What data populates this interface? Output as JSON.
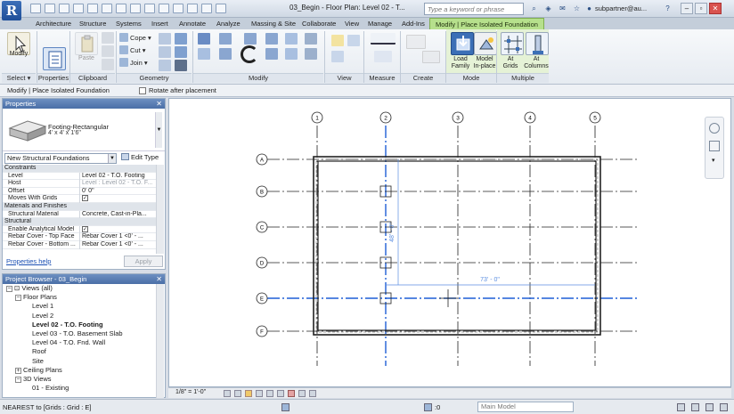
{
  "app": {
    "logo_letter": "R",
    "doc_title": "03_Begin - Floor Plan: Level 02 - T...",
    "search_placeholder": "Type a keyword or phrase",
    "user": "subpartner@au..."
  },
  "tabs": [
    "Architecture",
    "Structure",
    "Systems",
    "Insert",
    "Annotate",
    "Analyze",
    "Massing & Site",
    "Collaborate",
    "View",
    "Manage",
    "Add-Ins",
    "Modify | Place Isolated Foundation"
  ],
  "ribbon": {
    "select_label": "Select ▾",
    "panels": {
      "properties": "Properties",
      "clipboard": "Clipboard",
      "geometry": "Geometry",
      "modify": "Modify",
      "view": "View",
      "measure": "Measure",
      "create": "Create",
      "mode": "Mode",
      "multiple": "Multiple"
    },
    "modify_btn": "Modify",
    "paste": "Paste",
    "cope": "Cope",
    "cut": "Cut",
    "join": "Join",
    "load_family": [
      "Load",
      "Family"
    ],
    "model_inplace": [
      "Model",
      "In-place"
    ],
    "at_grids": [
      "At",
      "Grids"
    ],
    "at_columns": [
      "At",
      "Columns"
    ]
  },
  "optbar": {
    "mode": "Modify | Place Isolated Foundation",
    "rotate": "Rotate after placement"
  },
  "properties": {
    "title": "Properties",
    "family": "Footing-Rectangular",
    "type": "4' x 4' x 1'6\"",
    "instance_dropdown": "New Structural Foundations",
    "edit_type": "Edit Type",
    "rows": [
      {
        "k": "Constraints",
        "v": "",
        "sec": true
      },
      {
        "k": "Level",
        "v": "Level 02 - T.O. Footing"
      },
      {
        "k": "Host",
        "v": "Level : Level 02 - T.O. F...",
        "dim": true
      },
      {
        "k": "Offset",
        "v": "0' 0\""
      },
      {
        "k": "Moves With Grids",
        "v": "✓",
        "check": true
      },
      {
        "k": "Materials and Finishes",
        "v": "",
        "sec": true
      },
      {
        "k": "Structural Material",
        "v": "Concrete, Cast-in-Pla..."
      },
      {
        "k": "Structural",
        "v": "",
        "sec": true
      },
      {
        "k": "Enable Analytical Model",
        "v": "✓",
        "check": true
      },
      {
        "k": "Rebar Cover - Top Face",
        "v": "Rebar Cover 1 <0' - ..."
      },
      {
        "k": "Rebar Cover - Bottom ...",
        "v": "Rebar Cover 1 <0' - ..."
      }
    ],
    "help": "Properties help",
    "apply": "Apply"
  },
  "browser": {
    "title": "Project Browser - 03_Begin",
    "nodes": [
      {
        "label": "Views (all)",
        "depth": 0,
        "box": "−",
        "icon": true
      },
      {
        "label": "Floor Plans",
        "depth": 1,
        "box": "−"
      },
      {
        "label": "Level 1",
        "depth": 2
      },
      {
        "label": "Level 2",
        "depth": 2
      },
      {
        "label": "Level 02 - T.O. Footing",
        "depth": 2,
        "sel": true
      },
      {
        "label": "Level 03 - T.O. Basement Slab",
        "depth": 2
      },
      {
        "label": "Level 04 - T.O. Fnd. Wall",
        "depth": 2
      },
      {
        "label": "Roof",
        "depth": 2
      },
      {
        "label": "Site",
        "depth": 2
      },
      {
        "label": "Ceiling Plans",
        "depth": 1,
        "box": "+"
      },
      {
        "label": "3D Views",
        "depth": 1,
        "box": "−"
      },
      {
        "label": "01 - Existing",
        "depth": 2
      }
    ]
  },
  "canvas": {
    "grids_v": [
      "1",
      "2",
      "3",
      "4",
      "5"
    ],
    "grids_h": [
      "A",
      "B",
      "C",
      "D",
      "E",
      "F"
    ],
    "dim_vertical": "48' - 0\"",
    "dim_horizontal": "73' - 0\""
  },
  "viewctrl": {
    "scale": "1/8\" = 1'-0\""
  },
  "status": {
    "text": "NEAREST  to [Grids : Grid : E]",
    "zero": ":0",
    "model": "Main Model"
  },
  "colors": {
    "contextual_tab": "#b6e08c",
    "selection_blue": "#1f5fd6",
    "title_blue": "#4a6fa7"
  }
}
